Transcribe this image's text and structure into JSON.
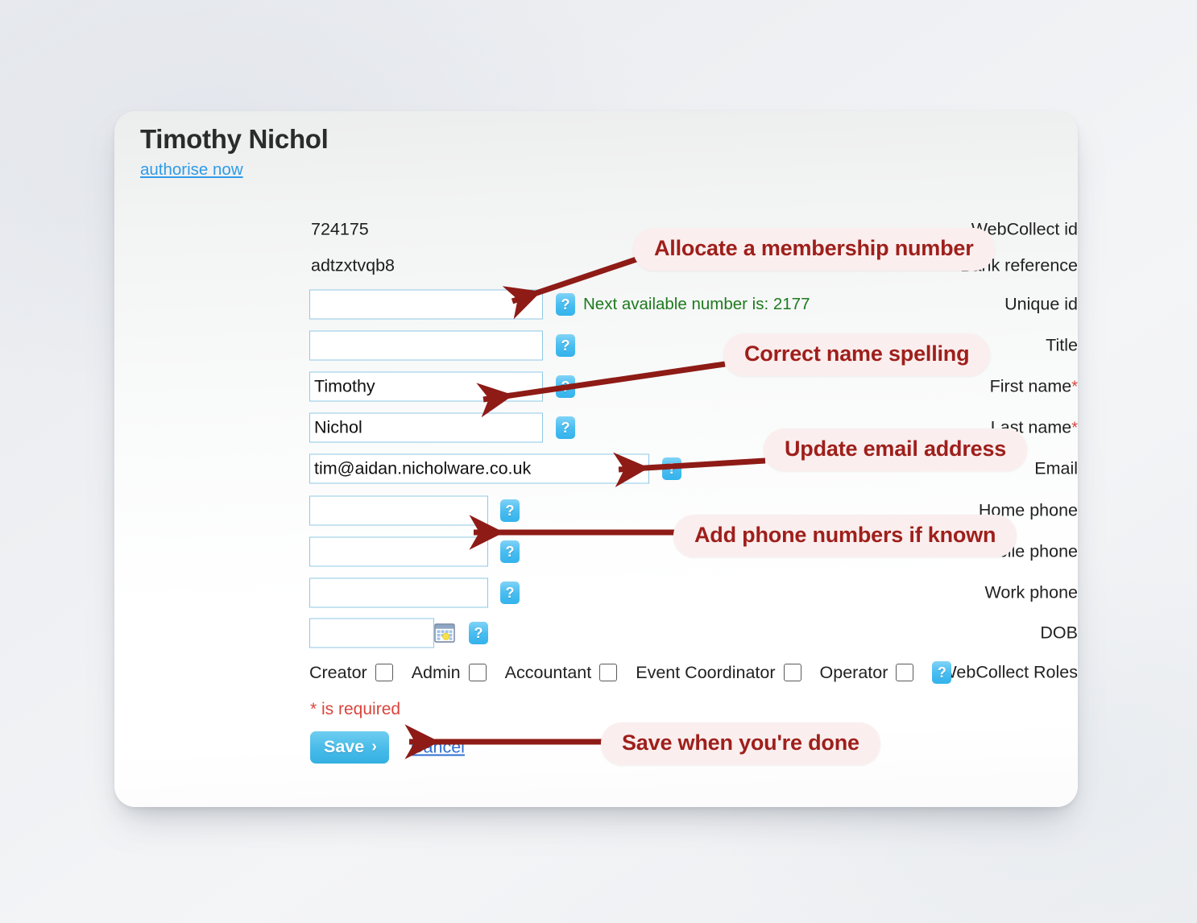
{
  "card": {
    "person_name": "Timothy Nichol",
    "authorise_link": "authorise now"
  },
  "readonly_fields": [
    {
      "label": "WebCollect id",
      "value": "724175"
    },
    {
      "label": "Bank reference",
      "value": "adtzxtvqb8"
    }
  ],
  "fields": {
    "unique_id": {
      "label": "Unique id",
      "value": "",
      "hint": "Next available number is: 2177"
    },
    "title": {
      "label": "Title",
      "value": ""
    },
    "first_name": {
      "label": "First name",
      "required_marker": "*",
      "value": "Timothy"
    },
    "last_name": {
      "label": "Last name",
      "required_marker": "*",
      "value": "Nichol"
    },
    "email": {
      "label": "Email",
      "value": "tim@aidan.nicholware.co.uk"
    },
    "home_phone": {
      "label": "Home phone",
      "value": ""
    },
    "mobile_phone": {
      "label": "Mobile phone",
      "value": ""
    },
    "work_phone": {
      "label": "Work phone",
      "value": ""
    },
    "dob": {
      "label": "DOB",
      "value": ""
    }
  },
  "roles": {
    "label": "WebCollect Roles",
    "items": [
      {
        "label": "Creator",
        "checked": false
      },
      {
        "label": "Admin",
        "checked": false
      },
      {
        "label": "Accountant",
        "checked": false
      },
      {
        "label": "Event Coordinator",
        "checked": false
      },
      {
        "label": "Operator",
        "checked": false
      }
    ]
  },
  "footer": {
    "required_note": "* is required",
    "save_label": "Save",
    "save_chevron": "›",
    "cancel_label": "Cancel"
  },
  "annotations": [
    {
      "text": "Allocate a membership number"
    },
    {
      "text": "Correct name spelling"
    },
    {
      "text": "Update email address"
    },
    {
      "text": "Add phone numbers if known"
    },
    {
      "text": "Save when you're done"
    }
  ],
  "colors": {
    "annotation_red": "#9e1f1b",
    "annotation_bg": "#faeeee",
    "link_blue": "#2f9be8",
    "hint_green": "#1e7a1e",
    "required_red": "#d9453c",
    "input_border": "#8fc9e4",
    "save_blue": "#47bbe9"
  },
  "icons": {
    "help": "?",
    "calendar": "calendar-icon"
  }
}
